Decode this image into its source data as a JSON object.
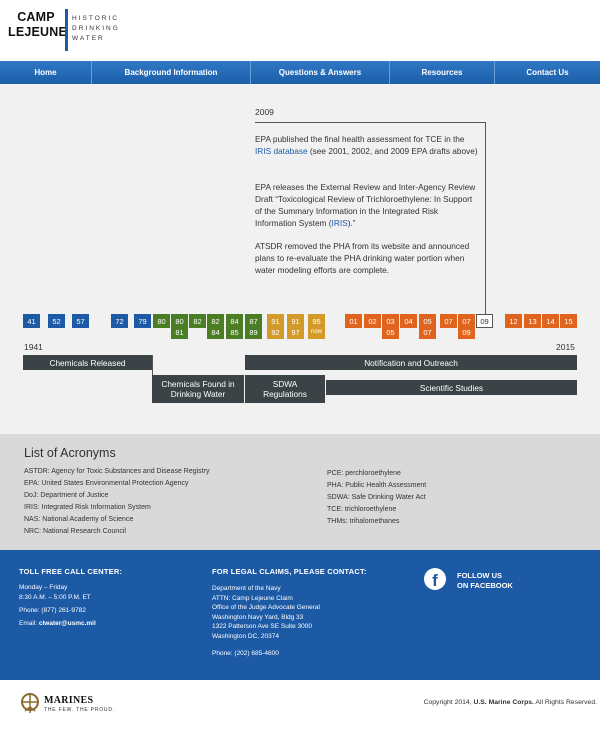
{
  "header": {
    "logo_line1": "CAMP",
    "logo_line2": "LEJEUNE",
    "logo_small1": "HISTORIC",
    "logo_small2": "DRINKING",
    "logo_small3": "WATER"
  },
  "nav": {
    "items": [
      "Home",
      "Background Information",
      "Questions & Answers",
      "Resources",
      "Contact Us"
    ]
  },
  "callout": {
    "year": "2009",
    "p1_before": "EPA published the final health assessment for TCE in the ",
    "p1_link": "IRIS database",
    "p1_after": " (see 2001, 2002, and 2009 EPA drafts above)",
    "p2_before": "EPA releases the External Review and Inter-Agency Review Draft “Toxicological Review of Trichloroethylene: In Support of the Summary Information in the Integrated Risk Information System (",
    "p2_link": "IRIS",
    "p2_after": ").”",
    "p3": "ATSDR removed the PHA from its website and announced plans to re-evaluate the PHA drinking water portion when water modeling efforts are complete."
  },
  "timeline": {
    "years_top": [
      "41",
      "52",
      "57",
      "72",
      "79",
      "80",
      "80",
      "82",
      "82",
      "84",
      "87",
      "91",
      "91",
      "95",
      "01",
      "02",
      "03",
      "04",
      "05",
      "07",
      "07",
      "09",
      "12",
      "13",
      "14",
      "15"
    ],
    "years_bottom": [
      "81",
      "84",
      "85",
      "89",
      "92",
      "97",
      "now",
      "05",
      "07",
      "09"
    ],
    "start_year": "1941",
    "end_year": "2015",
    "bars": {
      "chemicals_released": "Chemicals Released",
      "notification": "Notification and Outreach",
      "found_line1": "Chemicals Found in",
      "found_line2": "Drinking Water",
      "sdwa_line1": "SDWA",
      "sdwa_line2": "Regulations",
      "scientific": "Scientific Studies"
    },
    "colors": {
      "blue": "#1c5aa5",
      "green": "#4b7d24",
      "gold": "#d39a2a",
      "orange": "#e0631e"
    }
  },
  "acronyms": {
    "title": "List of Acronyms",
    "left": [
      "ASTDR:   Agency for Toxic Substances and Disease Registry",
      "EPA:   United States Environmental Protection Agency",
      "DoJ:   Department of Justice",
      "IRIS:   Integrated Risk Information System",
      "NAS:   National Academy of Science",
      "NRC:   National Research Council"
    ],
    "right": [
      "PCE:   perchloroethylene",
      "PHA:   Public Health Assessment",
      "SDWA:   Safe Drinking Water Act",
      "TCE:   trichloroethylene",
      "THMs:   trihalomethanes"
    ]
  },
  "footer": {
    "call_heading": "TOLL FREE CALL CENTER:",
    "hours1": "Monday – Friday",
    "hours2": "8:30 A.M. – 5:00 P.M. ET",
    "phone": "Phone: (877) 261-9782",
    "email_label": "Email: ",
    "email": "clwater@usmc.mil",
    "legal_heading": "FOR LEGAL CLAIMS, PLEASE CONTACT:",
    "address": [
      "Department of the Navy",
      "ATTN: Camp Lejeune Claim",
      "Office of the Judge Advocate General",
      "Washington Navy Yard, Bldg 33",
      "1322 Patterson Ave SE Suite 3000",
      "Washington DC, 20374"
    ],
    "legal_phone": "Phone: (202) 685-4600",
    "follow1": "FOLLOW US",
    "follow2": "ON FACEBOOK",
    "fb_icon": "facebook-icon"
  },
  "bottom": {
    "marines": "MARINES",
    "tagline": "THE FEW. THE PROUD.",
    "copy_before": "Copyright 2014, ",
    "copy_bold": "U.S. Marine Corps.",
    "copy_after": " All Rights Reserved."
  }
}
